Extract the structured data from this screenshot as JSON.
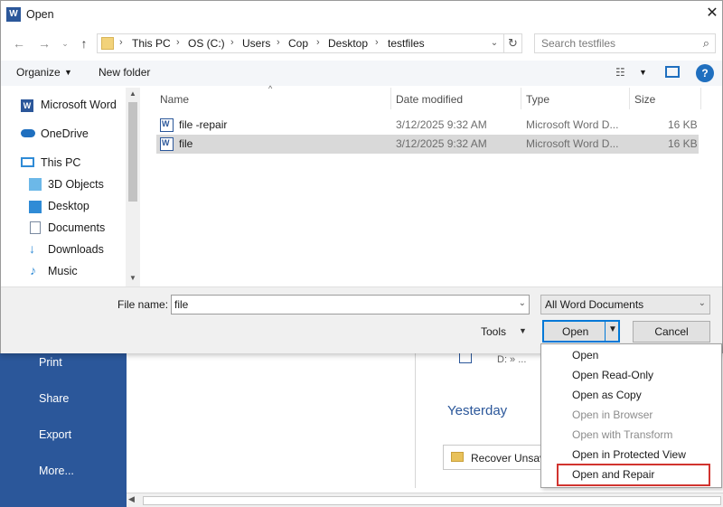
{
  "backstage": {
    "nav_items": [
      "Print",
      "Share",
      "Export",
      "More..."
    ],
    "recent_doc_path": "D: » ...",
    "yesterday_label": "Yesterday",
    "recover_label": "Recover Unsav"
  },
  "dialog": {
    "title": "Open",
    "breadcrumbs": [
      "This PC",
      "OS (C:)",
      "Users",
      "Cop",
      "Desktop",
      "testfiles"
    ],
    "search_placeholder": "Search testfiles",
    "toolbar": {
      "organize": "Organize",
      "new_folder": "New folder"
    },
    "navtree": [
      {
        "label": "Microsoft Word",
        "icon": "word-icon"
      },
      {
        "label": "OneDrive",
        "icon": "cloud-icon"
      },
      {
        "label": "This PC",
        "icon": "computer-icon"
      },
      {
        "label": "3D Objects",
        "icon": "cube-icon"
      },
      {
        "label": "Desktop",
        "icon": "desktop-icon"
      },
      {
        "label": "Documents",
        "icon": "document-icon"
      },
      {
        "label": "Downloads",
        "icon": "download-icon"
      },
      {
        "label": "Music",
        "icon": "music-icon"
      }
    ],
    "columns": {
      "name": "Name",
      "date": "Date modified",
      "type": "Type",
      "size": "Size"
    },
    "files": [
      {
        "name": "file -repair",
        "date": "3/12/2025 9:32 AM",
        "type": "Microsoft Word D...",
        "size": "16 KB",
        "selected": false
      },
      {
        "name": "file",
        "date": "3/12/2025 9:32 AM",
        "type": "Microsoft Word D...",
        "size": "16 KB",
        "selected": true
      }
    ],
    "filename_label": "File name:",
    "filename_value": "file",
    "filter_value": "All Word Documents",
    "tools_label": "Tools",
    "open_label": "Open",
    "cancel_label": "Cancel"
  },
  "open_menu": [
    {
      "label": "Open",
      "enabled": true
    },
    {
      "label": "Open Read-Only",
      "enabled": true
    },
    {
      "label": "Open as Copy",
      "enabled": true
    },
    {
      "label": "Open in Browser",
      "enabled": false
    },
    {
      "label": "Open with Transform",
      "enabled": false
    },
    {
      "label": "Open in Protected View",
      "enabled": true
    },
    {
      "label": "Open and Repair",
      "enabled": true,
      "highlighted": true
    }
  ],
  "colors": {
    "word_blue": "#2b579a",
    "accent": "#0078d7",
    "highlight_red": "#d1342f"
  }
}
